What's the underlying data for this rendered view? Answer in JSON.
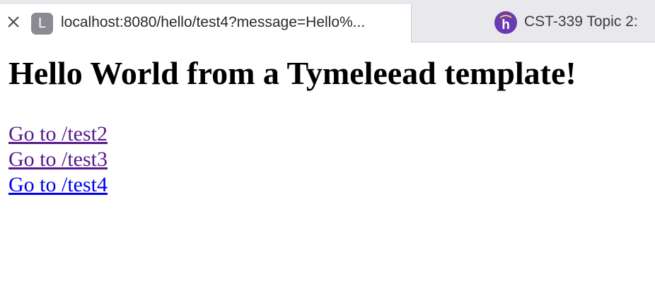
{
  "browser": {
    "tabs": [
      {
        "title": "localhost:8080/hello/test4?message=Hello%...",
        "favicon_letter": "L",
        "favicon_icon": "letter-l-favicon",
        "active": true
      },
      {
        "title": "CST-339 Topic 2:",
        "favicon_icon": "h-logo-icon",
        "active": false
      }
    ],
    "close_icon": "close-icon"
  },
  "page": {
    "heading": "Hello World from a Tymeleead template!",
    "links": [
      {
        "label": "Go to /test2",
        "state": "visited"
      },
      {
        "label": "Go to /test3",
        "state": "visited"
      },
      {
        "label": "Go to /test4",
        "state": "unvisited"
      }
    ]
  },
  "colors": {
    "visited_link": "#551a8b",
    "unvisited_link": "#0000ee",
    "tab_bar": "#e9e8ec",
    "favicon_purple": "#6a3ab1"
  }
}
